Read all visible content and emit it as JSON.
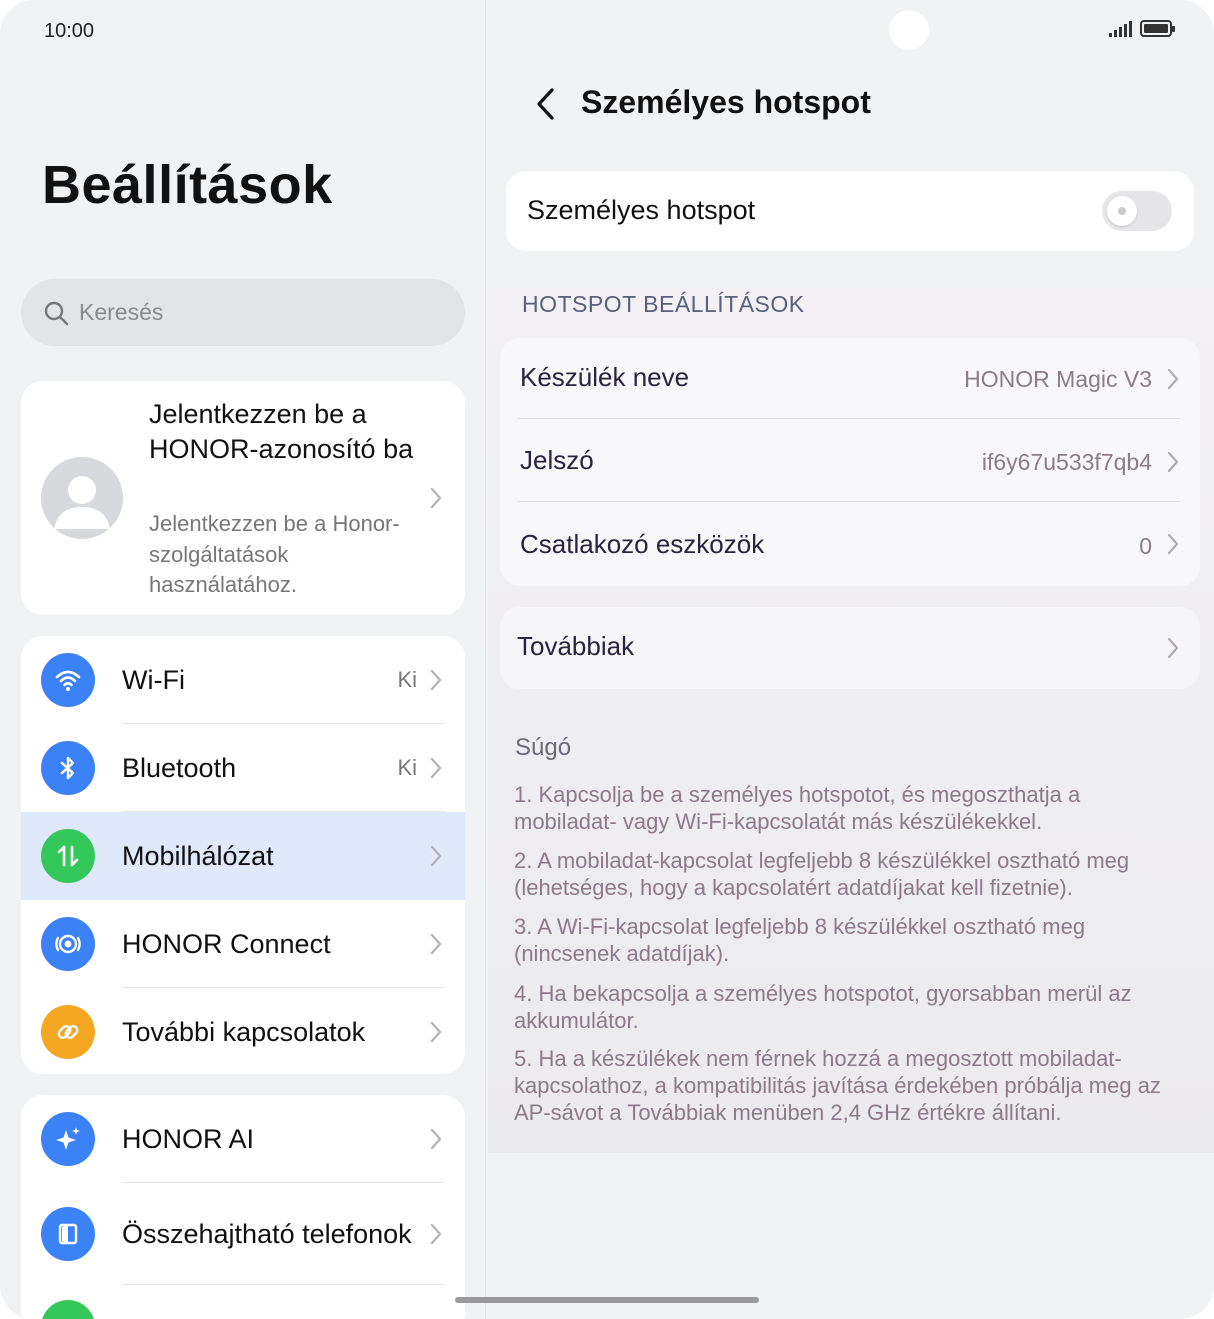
{
  "status_bar": {
    "time": "10:00"
  },
  "left": {
    "title": "Beállítások",
    "search": {
      "placeholder": "Keresés"
    },
    "account": {
      "title": "Jelentkezzen be a HONOR-azonosító ba",
      "subtitle": "Jelentkezzen be a Honor-szolgáltatások használatához."
    },
    "group1": [
      {
        "label": "Wi-Fi",
        "value": "Ki",
        "icon": "wifi-icon",
        "color": "#3b82f6"
      },
      {
        "label": "Bluetooth",
        "value": "Ki",
        "icon": "bluetooth-icon",
        "color": "#3b82f6"
      },
      {
        "label": "Mobilhálózat",
        "value": "",
        "icon": "mobile-data-icon",
        "color": "#34c759"
      },
      {
        "label": "HONOR Connect",
        "value": "",
        "icon": "honor-connect-icon",
        "color": "#3b82f6"
      },
      {
        "label": "További kapcsolatok",
        "value": "",
        "icon": "link-icon",
        "color": "#f5a623"
      }
    ],
    "group2": [
      {
        "label": "HONOR AI",
        "icon": "ai-sparkle-icon",
        "color": "#3b82f6"
      },
      {
        "label": "Összehajtható telefonok",
        "icon": "foldable-phone-icon",
        "color": "#3b82f6"
      }
    ]
  },
  "right": {
    "title": "Személyes hotspot",
    "toggle_label": "Személyes hotspot",
    "toggle_on": false,
    "section_header": "HOTSPOT BEÁLLÍTÁSOK",
    "settings": [
      {
        "label": "Készülék neve",
        "value": "HONOR Magic V3"
      },
      {
        "label": "Jelszó",
        "value": "if6y67u533f7qb4"
      },
      {
        "label": "Csatlakozó eszközök",
        "value": "0"
      }
    ],
    "more_label": "Továbbiak",
    "help": {
      "title": "Súgó",
      "items": [
        "1. Kapcsolja be a személyes hotspotot, és megoszthatja a mobiladat- vagy Wi-Fi-kapcsolatát más készülékekkel.",
        "2. A mobiladat-kapcsolat legfeljebb 8 készülékkel osztható meg (lehetséges, hogy a kapcsolatért adatdíjakat kell fizetnie).",
        "3. A Wi-Fi-kapcsolat legfeljebb 8 készülékkel osztható meg (nincsenek adatdíjak).",
        "4. Ha bekapcsolja a személyes hotspotot, gyorsabban merül az akkumulátor.",
        "5. Ha a készülékek nem férnek hozzá a megosztott mobiladat-kapcsolathoz, a kompatibilitás javítása érdekében próbálja meg az AP-sávot a Továbbiak menüben 2,4 GHz értékre állítani."
      ]
    }
  }
}
